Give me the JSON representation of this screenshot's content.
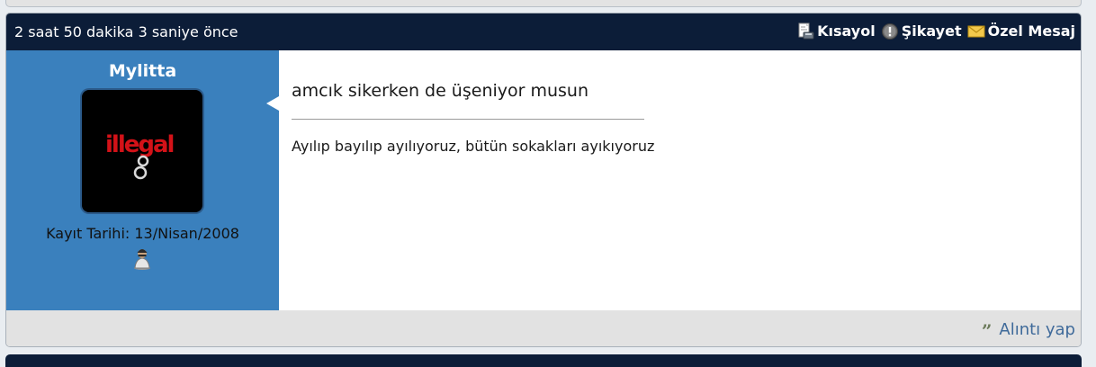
{
  "post": {
    "time": "2 saat 50 dakika 3 saniye önce",
    "actions": {
      "shortcut": "Kısayol",
      "report": "Şikayet",
      "private_message": "Özel Mesaj"
    },
    "author": {
      "name": "Mylitta",
      "avatar_text": "illegal",
      "registration": "Kayıt Tarihi: 13/Nisan/2008"
    },
    "message": "amcık sikerken de üşeniyor musun",
    "signature": "Ayılıp bayılıp ayılıyoruz, bütün sokakları ayıkıyoruz",
    "footer": {
      "quote_label": "Alıntı yap",
      "quote_icon": "”"
    }
  },
  "colors": {
    "header_bg": "#0c1d38",
    "author_panel_bg": "#3a80bd",
    "footer_bg": "#e2e2e2",
    "link": "#3f6a9a"
  },
  "icons": {
    "shortcut": "document-print-icon",
    "report": "warning-circle-icon",
    "private_message": "envelope-icon",
    "rank": "user-rank-icon",
    "quote": "quote-icon"
  }
}
